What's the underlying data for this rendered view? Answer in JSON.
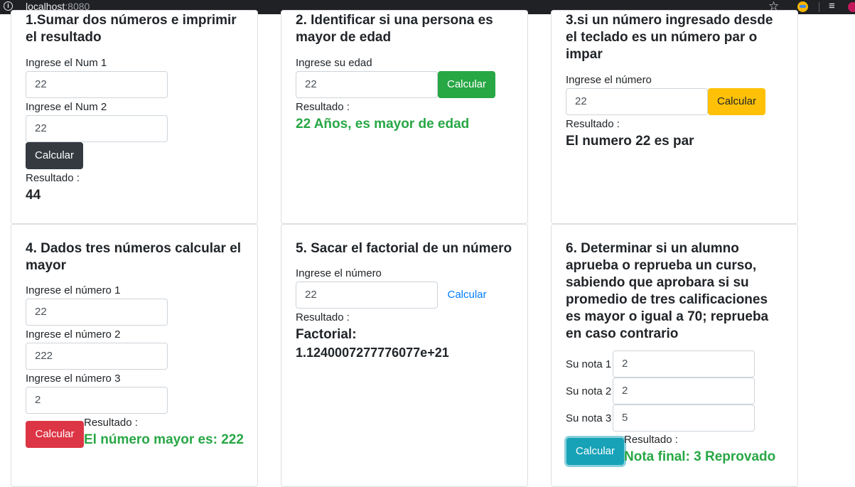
{
  "browser": {
    "host": "localhost",
    "port": ":8080"
  },
  "cards": [
    {
      "title": "1.Sumar dos números e imprimir el resultado",
      "label1": "Ingrese el Num 1",
      "value1": "22",
      "label2": "Ingrese el Num 2",
      "value2": "22",
      "button": "Calcular",
      "result_label": "Resultado :",
      "result": "44"
    },
    {
      "title": "2. Identificar si una persona es mayor de edad",
      "label1": "Ingrese su edad",
      "value1": "22",
      "button": "Calcular",
      "result_label": "Resultado :",
      "result": "22 Años, es mayor de edad"
    },
    {
      "title": "3.si un número ingresado desde el teclado es un número par o impar",
      "label1": "Ingrese el número",
      "value1": "22",
      "button": "Calcular",
      "result_label": "Resultado :",
      "result": "El numero 22 es par"
    },
    {
      "title": "4. Dados tres números calcular el mayor",
      "label1": "Ingrese el número 1",
      "value1": "22",
      "label2": "Ingrese el número 2",
      "value2": "222",
      "label3": "Ingrese el número 3",
      "value3": "2",
      "button": "Calcular",
      "result_label": "Resultado :",
      "result": "El número mayor es: 222"
    },
    {
      "title": "5. Sacar el factorial de un número",
      "label1": "Ingrese el número",
      "value1": "22",
      "button": "Calcular",
      "result_label": "Resultado :",
      "result_line1": "Factorial:",
      "result_line2": "1.1240007277776077e+21"
    },
    {
      "title": "6. Determinar si un alumno aprueba o reprueba un curso, sabiendo que aprobara si su promedio de tres calificaciones es mayor o igual a 70; reprueba en caso contrario",
      "label1": "Su nota 1",
      "value1": "2",
      "label2": "Su nota 2",
      "value2": "2",
      "label3": "Su nota 3",
      "value3": "5",
      "button": "Calcular",
      "result_label": "Resultado :",
      "result": "Nota final: 3 Reprovado"
    }
  ]
}
